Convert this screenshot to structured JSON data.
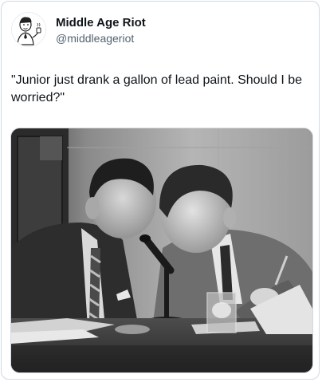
{
  "tweet": {
    "author": {
      "display_name": "Middle Age Riot",
      "handle": "@middleageriot",
      "avatar_icon": "cartoon-man-avatar-icon"
    },
    "text": "\"Junior just drank a gallon of lead paint. Should I be worried?\"",
    "media": {
      "type": "photo",
      "style": "black-and-white",
      "icon": "photo-two-men-whispering-at-microphone"
    }
  },
  "colors": {
    "text_primary": "#0f1419",
    "text_secondary": "#536471",
    "border": "#cfd9de",
    "background": "#ffffff"
  }
}
